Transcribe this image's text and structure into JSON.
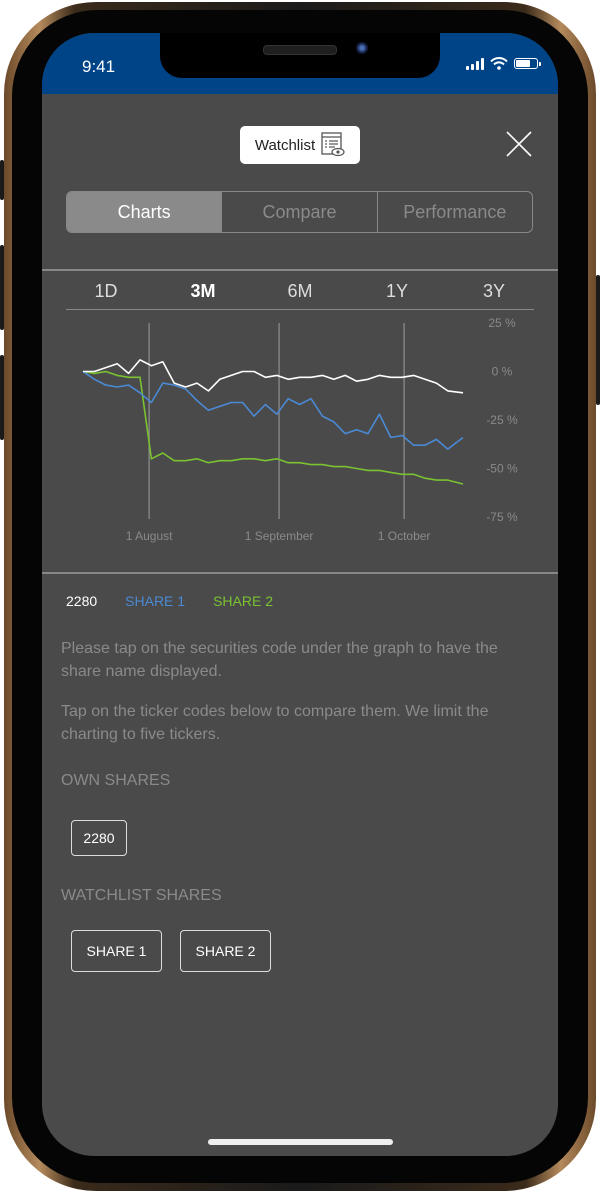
{
  "status_bar": {
    "time": "9:41"
  },
  "header": {
    "watchlist_label": "Watchlist",
    "watchlist_icon": "list-eye-icon",
    "close_icon": "close-x-icon"
  },
  "tabs": [
    {
      "label": "Charts",
      "active": true
    },
    {
      "label": "Compare",
      "active": false
    },
    {
      "label": "Performance",
      "active": false
    }
  ],
  "ranges": [
    {
      "label": "1D",
      "active": false
    },
    {
      "label": "3M",
      "active": true
    },
    {
      "label": "6M",
      "active": false
    },
    {
      "label": "1Y",
      "active": false
    },
    {
      "label": "3Y",
      "active": false
    }
  ],
  "chart_data": {
    "type": "line",
    "title": "",
    "xlabel": "",
    "ylabel": "",
    "x_ticks": [
      "1 August",
      "1 September",
      "1 October"
    ],
    "x_tick_positions": [
      0.174,
      0.516,
      0.845
    ],
    "y_ticks": [
      "25 %",
      "0 %",
      "-25 %",
      "-50 %",
      "-75 %"
    ],
    "y_tick_values": [
      25,
      0,
      -25,
      -50,
      -75
    ],
    "ylim": [
      -75,
      25
    ],
    "grid": "vertical at x ticks",
    "legend": "bottom-left",
    "x": [
      0,
      0.03,
      0.06,
      0.09,
      0.12,
      0.15,
      0.18,
      0.21,
      0.24,
      0.27,
      0.3,
      0.33,
      0.36,
      0.39,
      0.42,
      0.45,
      0.48,
      0.51,
      0.54,
      0.57,
      0.6,
      0.63,
      0.66,
      0.69,
      0.72,
      0.75,
      0.78,
      0.81,
      0.84,
      0.87,
      0.9,
      0.93,
      0.96,
      1.0
    ],
    "series": [
      {
        "name": "2280",
        "color": "#ffffff",
        "values": [
          0,
          0,
          2,
          4,
          -1,
          6,
          3,
          5,
          -6,
          -8,
          -6,
          -10,
          -4,
          -2,
          0,
          0,
          -3,
          -2,
          -4,
          -3,
          -3,
          -2,
          -4,
          -2,
          -5,
          -4,
          -2,
          -3,
          -3,
          -2,
          -4,
          -6,
          -10,
          -11
        ]
      },
      {
        "name": "SHARE 1",
        "color": "#4a8ad4",
        "values": [
          0,
          -4,
          -7,
          -8,
          -7,
          -11,
          -16,
          -6,
          -7,
          -9,
          -15,
          -20,
          -18,
          -16,
          -16,
          -23,
          -17,
          -22,
          -14,
          -17,
          -14,
          -23,
          -26,
          -32,
          -30,
          -32,
          -22,
          -34,
          -33,
          -38,
          -38,
          -35,
          -40,
          -34
        ]
      },
      {
        "name": "SHARE 2",
        "color": "#7ac231",
        "values": [
          0,
          -1,
          0,
          -2,
          -3,
          -3,
          -45,
          -42,
          -46,
          -46,
          -45,
          -47,
          -46,
          -46,
          -45,
          -45,
          -46,
          -45,
          -47,
          -47,
          -48,
          -48,
          -49,
          -49,
          -50,
          -51,
          -51,
          -52,
          -53,
          -53,
          -55,
          -56,
          -56,
          -58
        ]
      }
    ]
  },
  "legend_items": [
    {
      "label": "2280",
      "color": "#ffffff"
    },
    {
      "label": "SHARE 1",
      "color": "#4a8ad4"
    },
    {
      "label": "SHARE 2",
      "color": "#7ac231"
    }
  ],
  "info": {
    "text1": "Please tap on the securities code under the graph to have the share name displayed.",
    "text2": "Tap on the ticker codes below to compare them. We limit the charting to five tickers."
  },
  "own_shares": {
    "label": "OWN SHARES",
    "items": [
      "2280"
    ]
  },
  "watchlist_shares": {
    "label": "WATCHLIST SHARES",
    "items": [
      "SHARE 1",
      "SHARE 2"
    ]
  }
}
